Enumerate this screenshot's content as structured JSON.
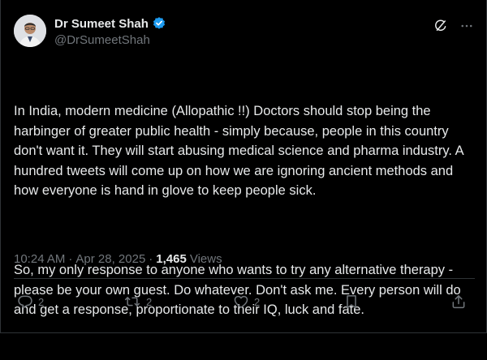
{
  "author": {
    "name": "Dr Sumeet Shah",
    "handle": "@DrSumeetShah",
    "verified_color": "#1d9bf0"
  },
  "tweet": {
    "paragraphs": [
      "In India, modern medicine (Allopathic !!) Doctors should stop being the harbinger of greater public health - simply because, people in this country don't want it. They will start abusing medical science and pharma industry. A hundred tweets will come up on how we are ignoring ancient methods and how everyone is hand in glove to keep people sick.",
      "So, my only response to anyone who wants to try any alternative therapy - please be your own guest. Do whatever. Don't ask me. Every person will do and get a response, proportionate to their IQ, luck and fate."
    ],
    "time": "10:24 AM",
    "separator1": "·",
    "date": "Apr 28, 2025",
    "separator2": "·",
    "views_count": "1,465",
    "views_label": "Views"
  },
  "actions": {
    "reply_count": "2",
    "repost_count": "2",
    "like_count": "2"
  },
  "icons": {
    "header": [
      "grok-icon",
      "more-icon"
    ],
    "actions": [
      "reply-icon",
      "repost-icon",
      "like-icon",
      "bookmark-icon",
      "share-icon"
    ]
  },
  "colors": {
    "background": "#000000",
    "text": "#e7e9ea",
    "muted": "#71767b",
    "border": "#2f3336"
  }
}
